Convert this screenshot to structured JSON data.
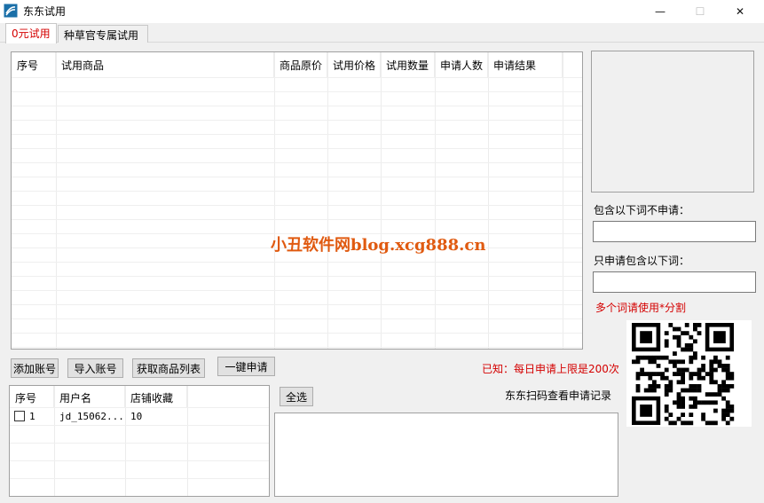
{
  "window": {
    "title": "东东试用",
    "minimize": "—",
    "maximize": "☐",
    "close": "✕"
  },
  "tabs": [
    {
      "label": "0元试用"
    },
    {
      "label": "种草官专属试用"
    }
  ],
  "product_table": {
    "columns": [
      "序号",
      "试用商品",
      "商品原价",
      "试用价格",
      "试用数量",
      "申请人数",
      "申请结果"
    ]
  },
  "filters": {
    "exclude_label": "包含以下词不申请：",
    "exclude_value": "",
    "include_label": "只申请包含以下词：",
    "include_value": "",
    "hint": "多个词请使用*分割"
  },
  "actions": {
    "add_account": "添加账号",
    "import_account": "导入账号",
    "fetch_products": "获取商品列表",
    "apply_all": "一键申请",
    "select_all": "全选"
  },
  "notices": {
    "daily_limit": "已知：每日申请上限是200次",
    "scan_qr": "东东扫码查看申请记录"
  },
  "watermark": "小丑软件网blog.xcg888.cn",
  "accounts_table": {
    "columns": [
      "序号",
      "用户名",
      "店铺收藏"
    ],
    "rows": [
      {
        "index": "1",
        "username": "jd_15062...",
        "favorites": "10"
      }
    ]
  },
  "colors": {
    "accent_red": "#d40000",
    "watermark_orange": "#e05a10"
  }
}
